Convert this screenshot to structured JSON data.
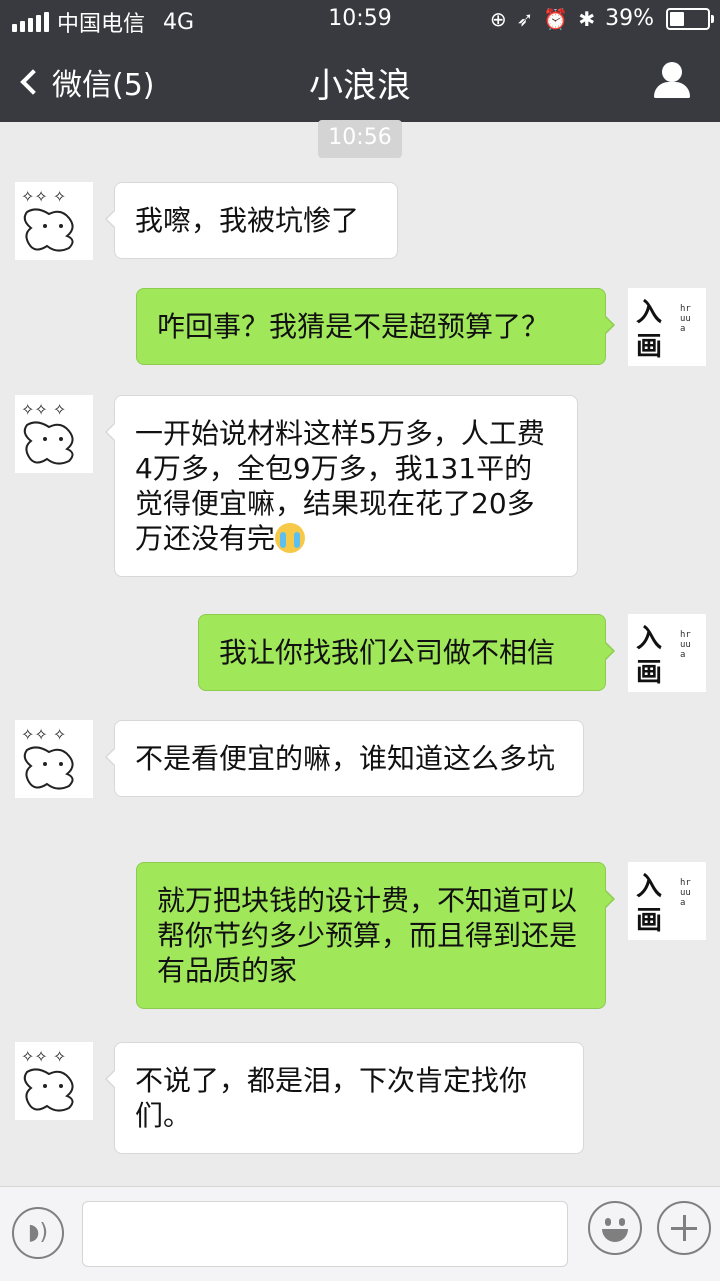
{
  "status_bar": {
    "carrier": "中国电信",
    "network": "4G",
    "time": "10:59",
    "battery": "39%",
    "battery_level": 0.39,
    "icons": [
      "signal-icon",
      "lock-rotation-icon",
      "location-icon",
      "alarm-icon",
      "bluetooth-icon",
      "battery-icon"
    ]
  },
  "nav": {
    "back_label": "微信(5)",
    "title": "小浪浪",
    "profile_icon": "person-icon"
  },
  "chat": {
    "timestamp": "10:56",
    "messages": [
      {
        "side": "left",
        "text": "我嚓，我被坑惨了"
      },
      {
        "side": "right",
        "text": "咋回事？我猜是不是超预算了？"
      },
      {
        "side": "left",
        "text": "一开始说材料这样5万多，人工费4万多，全包9万多，我131平的觉得便宜嘛，结果现在花了20多万还没有完",
        "emoji": "crying-emoji"
      },
      {
        "side": "right",
        "text": "我让你找我们公司做不相信"
      },
      {
        "side": "left",
        "text": "不是看便宜的嘛，谁知道这么多坑"
      },
      {
        "side": "right",
        "text": "就万把块钱的设计费，不知道可以帮你节约多少预算，而且得到还是有品质的家"
      },
      {
        "side": "left",
        "text": "不说了，都是泪，下次肯定找你们。"
      }
    ],
    "brand_avatar": {
      "char1": "入",
      "char2": "画",
      "small": "hruua"
    }
  },
  "input_bar": {
    "placeholder": "",
    "icons": [
      "voice-icon",
      "emoji-icon",
      "plus-icon"
    ]
  }
}
